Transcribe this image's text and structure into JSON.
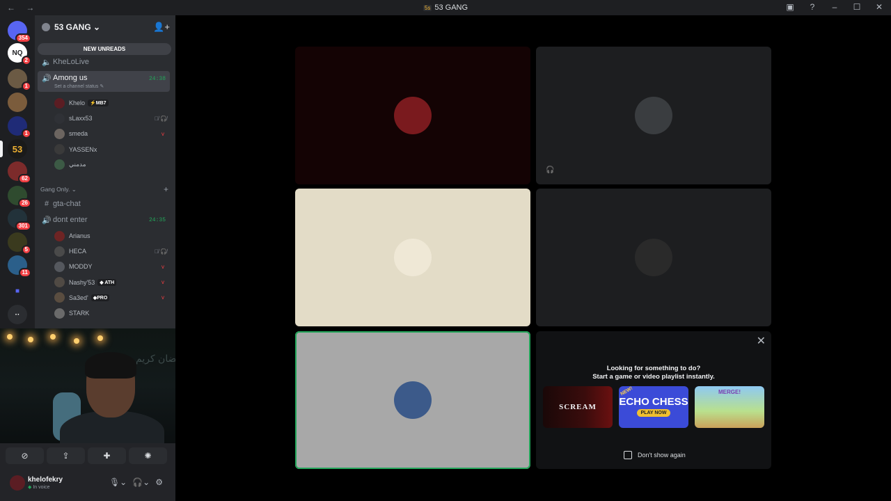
{
  "window": {
    "title": "53 GANG",
    "title_icon": "5s",
    "nav": "← →",
    "controls": [
      "screen-share-icon",
      "help-icon",
      "minimize-icon",
      "maximize-icon",
      "close-icon"
    ]
  },
  "guilds": [
    {
      "name": "direct-messages",
      "badge": "354",
      "label": "",
      "color": "#5865f2"
    },
    {
      "name": "guild-nq",
      "badge": "2",
      "label": "NQ",
      "color": "#ffffff"
    },
    {
      "name": "guild-2",
      "badge": "1",
      "label": "",
      "color": "#6b5a44"
    },
    {
      "name": "guild-3",
      "badge": "",
      "label": "",
      "color": "#7b5c3c"
    },
    {
      "name": "guild-4",
      "badge": "1",
      "label": "",
      "color": "#1f2b77"
    },
    {
      "name": "guild-53",
      "badge": "",
      "label": "53",
      "color": "#1a1a1a"
    },
    {
      "name": "guild-6",
      "badge": "62",
      "label": "",
      "color": "#7c2b2b"
    },
    {
      "name": "guild-7",
      "badge": "26",
      "label": "",
      "color": "#2f4b2f"
    },
    {
      "name": "guild-8",
      "badge": "301",
      "label": "",
      "color": "#22323a"
    },
    {
      "name": "guild-9",
      "badge": "5",
      "label": "",
      "color": "#3a3a1e"
    },
    {
      "name": "guild-10",
      "badge": "11",
      "label": "",
      "color": "#2b5f8a"
    }
  ],
  "server": {
    "name": "53 GANG",
    "new_unreads": "NEW UNREADS",
    "channels_top": [
      {
        "name": "KheLoLive",
        "icon": "speaker"
      }
    ],
    "active_channel": {
      "name": "Among us",
      "timer": "24:38",
      "status": "Set a channel status ✎"
    },
    "active_members": [
      {
        "name": "Khelo",
        "tag": "⚡MB7",
        "avatar": "#5b1d23",
        "icons": ""
      },
      {
        "name": "sLaxx53",
        "tag": "",
        "avatar": "#2f3136",
        "icons": "🎙̸ 🎧̸"
      },
      {
        "name": "smeda",
        "tag": "",
        "avatar": "#6c6560",
        "icons": "v"
      },
      {
        "name": "YASSENx",
        "tag": "",
        "avatar": "#3a3a3a",
        "icons": ""
      },
      {
        "name": "مدمني",
        "tag": "",
        "avatar": "#3c5a45",
        "icons": ""
      }
    ],
    "category": "Gang Only.",
    "text_channel": "gta-chat",
    "voice_channel_2": {
      "name": "dont enter",
      "timer": "24:35"
    },
    "voice_members_2": [
      {
        "name": "Arianus",
        "tag": "",
        "avatar": "#6e2424",
        "icons": ""
      },
      {
        "name": "HECA",
        "tag": "",
        "avatar": "#4a4a4a",
        "icons": "🎙̸ 🎧̸"
      },
      {
        "name": "MODDY",
        "tag": "",
        "avatar": "#55585e",
        "icons": "v"
      },
      {
        "name": "Nashy'53",
        "tag": "◆ ATH",
        "avatar": "#504a44",
        "icons": "v"
      },
      {
        "name": "Sa3ed'",
        "tag": "◆PRO",
        "avatar": "#5a4d40",
        "icons": "v"
      },
      {
        "name": "STARK",
        "tag": "",
        "avatar": "#6a6a6a",
        "icons": ""
      }
    ]
  },
  "webcam": {
    "overlay_text": "رمضان كريم"
  },
  "voice_controls": [
    "camera-off-icon",
    "screen-share-icon",
    "activities-icon",
    "soundboard-icon"
  ],
  "user": {
    "name": "khelofekry",
    "status": "In voice"
  },
  "stage": {
    "tiles": [
      {
        "name": "tile-khelo",
        "bg": "#140304",
        "avatar": "#7a1a1e",
        "muted": false,
        "speaking": false
      },
      {
        "name": "tile-slaxx",
        "bg": "#1d1e20",
        "avatar": "#3a3d40",
        "muted": true,
        "speaking": false
      },
      {
        "name": "tile-smeda",
        "bg": "#e3dcc7",
        "avatar": "#efe8d6",
        "muted": false,
        "speaking": false
      },
      {
        "name": "tile-yassen",
        "bg": "#1d1e20",
        "avatar": "#2a2a2a",
        "muted": false,
        "speaking": false
      },
      {
        "name": "tile-madmani",
        "bg": "#a8a8a8",
        "avatar": "#3c5a8a",
        "muted": false,
        "speaking": true
      }
    ],
    "activity": {
      "line1": "Looking for something to do?",
      "line2": "Start a game or video playlist instantly.",
      "games": [
        {
          "name": "SCREAM",
          "label": "SCREAM"
        },
        {
          "name": "ECHO CHESS",
          "label": "ECHO CHESS",
          "badge": "NEW!",
          "cta": "PLAY NOW"
        },
        {
          "name": "MERGE",
          "label": "MERGE!"
        }
      ],
      "dont_show": "Don't show again"
    }
  },
  "colors": {
    "accent_green": "#23a55a",
    "badge_red": "#f23f43"
  }
}
